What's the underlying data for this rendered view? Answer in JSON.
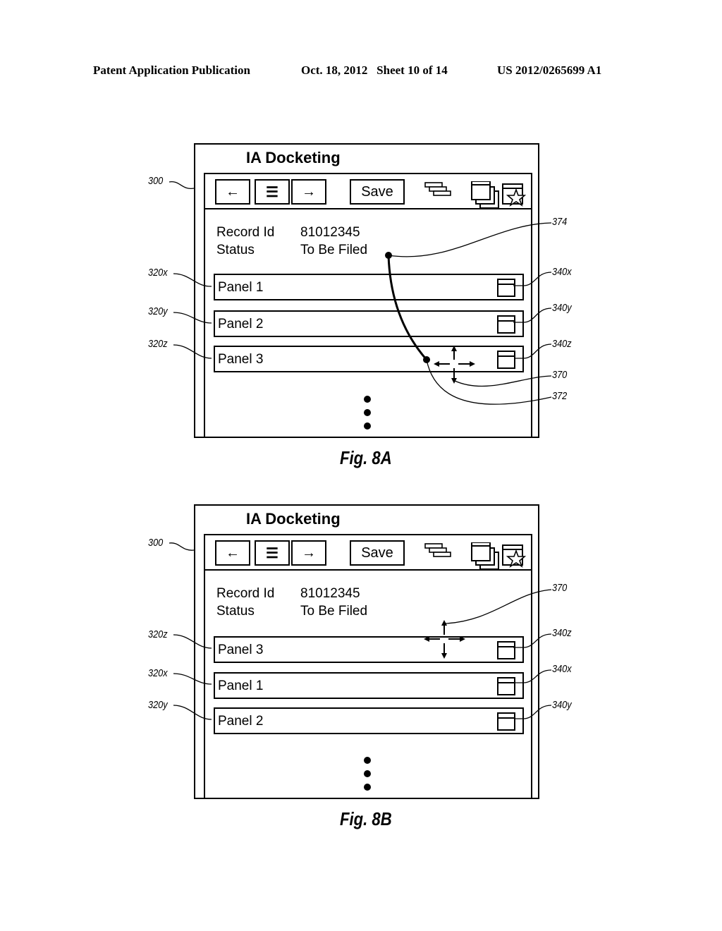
{
  "header": {
    "publication": "Patent Application Publication",
    "date_sheet": "Oct. 18, 2012   Sheet 10 of 14",
    "number": "US 2012/0265699 A1"
  },
  "figures": [
    {
      "caption": "Fig. 8A",
      "app_title": "IA Docketing",
      "toolbar": {
        "back": "←",
        "menu": "☰",
        "forward": "→",
        "save": "Save"
      },
      "info": [
        {
          "label": "Record Id",
          "value": "81012345"
        },
        {
          "label": "Status",
          "value": "To Be Filed"
        }
      ],
      "panels": [
        {
          "label": "Panel 1",
          "ref_left": "320x",
          "ref_right": "340x"
        },
        {
          "label": "Panel 2",
          "ref_left": "320y",
          "ref_right": "340y"
        },
        {
          "label": "Panel 3",
          "ref_left": "320z",
          "ref_right": "340z"
        }
      ],
      "refs": {
        "window": "300",
        "gesture_path": "374",
        "move_cursor": "370",
        "drop_point": "372"
      }
    },
    {
      "caption": "Fig. 8B",
      "app_title": "IA Docketing",
      "toolbar": {
        "back": "←",
        "menu": "☰",
        "forward": "→",
        "save": "Save"
      },
      "info": [
        {
          "label": "Record Id",
          "value": "81012345"
        },
        {
          "label": "Status",
          "value": "To Be Filed"
        }
      ],
      "panels": [
        {
          "label": "Panel 3",
          "ref_left": "320z",
          "ref_right": "340z"
        },
        {
          "label": "Panel 1",
          "ref_left": "320x",
          "ref_right": "340x"
        },
        {
          "label": "Panel 2",
          "ref_left": "320y",
          "ref_right": "340y"
        }
      ],
      "refs": {
        "window": "300",
        "move_cursor": "370"
      }
    }
  ],
  "icons": {
    "toolbar_right": [
      "stacked-bars-icon",
      "cascade-windows-icon",
      "window-star-icon"
    ],
    "panel": "panel-window-icon",
    "cursor": "move-arrows-icon"
  }
}
